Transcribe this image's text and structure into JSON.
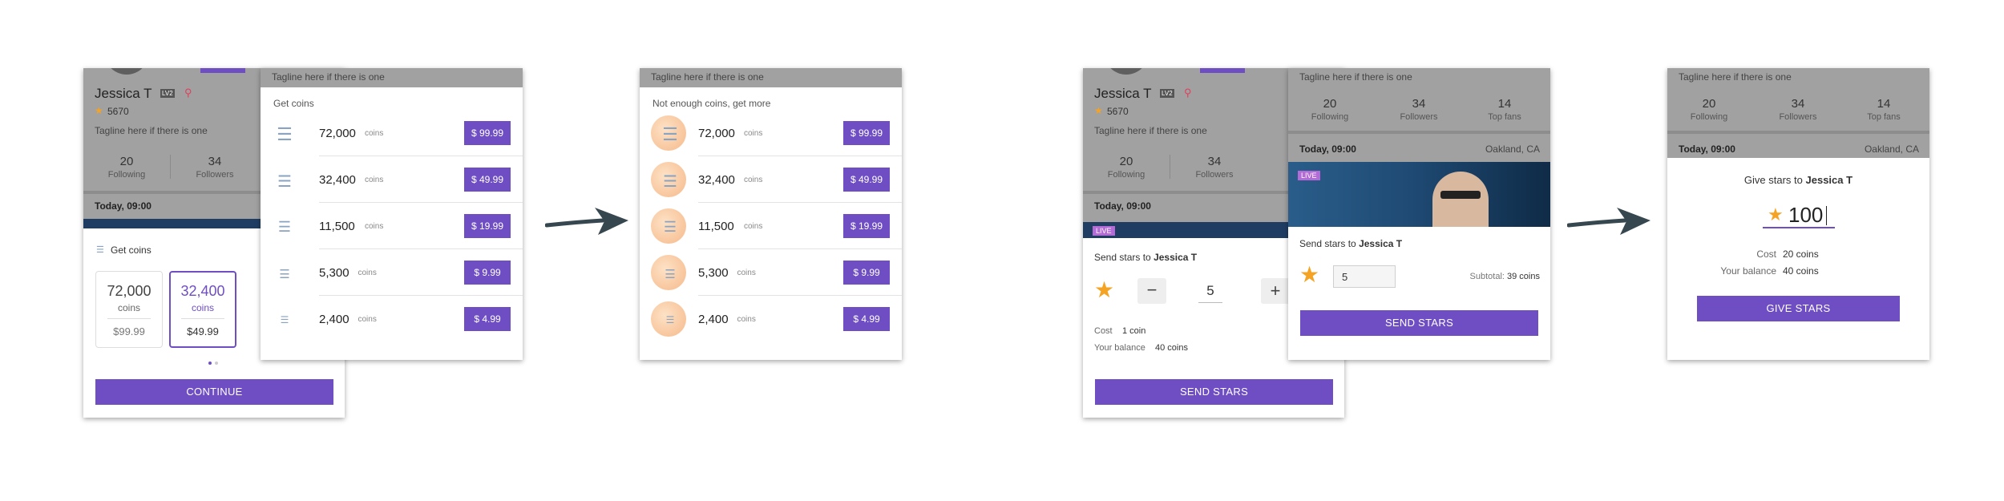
{
  "profile": {
    "name": "Jessica T",
    "level_badge": "LV2",
    "score": "5670",
    "tagline": "Tagline here if there is one",
    "stats": [
      {
        "value": "20",
        "label": "Following"
      },
      {
        "value": "34",
        "label": "Followers"
      },
      {
        "value": "14",
        "label": "Top fans"
      }
    ],
    "schedule": "Today, 09:00",
    "location": "Oakland, CA",
    "live_badge": "LIVE"
  },
  "coin_picker": {
    "title": "Get coins",
    "options": [
      {
        "amount": "72,000",
        "unit": "coins",
        "price": "$99.99",
        "selected": false
      },
      {
        "amount": "32,400",
        "unit": "coins",
        "price": "$49.99",
        "selected": true
      }
    ],
    "continue_label": "CONTINUE"
  },
  "coin_list": {
    "title": "Get coins",
    "items": [
      {
        "amount": "72,000",
        "unit": "coins",
        "price": "$ 99.99"
      },
      {
        "amount": "32,400",
        "unit": "coins",
        "price": "$ 49.99"
      },
      {
        "amount": "11,500",
        "unit": "coins",
        "price": "$ 19.99"
      },
      {
        "amount": "5,300",
        "unit": "coins",
        "price": "$ 9.99"
      },
      {
        "amount": "2,400",
        "unit": "coins",
        "price": "$ 4.99"
      }
    ]
  },
  "coin_list_more": {
    "title": "Not enough coins, get more",
    "items": [
      {
        "amount": "72,000",
        "unit": "coins",
        "price": "$ 99.99"
      },
      {
        "amount": "32,400",
        "unit": "coins",
        "price": "$ 49.99"
      },
      {
        "amount": "11,500",
        "unit": "coins",
        "price": "$ 19.99"
      },
      {
        "amount": "5,300",
        "unit": "coins",
        "price": "$ 9.99"
      },
      {
        "amount": "2,400",
        "unit": "coins",
        "price": "$ 4.99"
      }
    ]
  },
  "send_stars_stepper": {
    "title_prefix": "Send stars to",
    "recipient": "Jessica T",
    "quantity": "5",
    "minus": "−",
    "plus": "+",
    "cost_label": "Cost",
    "cost_value": "1 coin",
    "balance_label": "Your balance",
    "balance_value": "40 coins",
    "button_label": "SEND STARS"
  },
  "send_stars_input": {
    "title_prefix": "Send stars to",
    "recipient": "Jessica T",
    "quantity": "5",
    "subtotal_label": "Subtotal:",
    "subtotal_value": "39 coins",
    "button_label": "SEND STARS"
  },
  "give_stars": {
    "title_prefix": "Give stars to",
    "recipient": "Jessica T",
    "amount": "100",
    "cost_label": "Cost",
    "cost_value": "20 coins",
    "balance_label": "Your balance",
    "balance_value": "40 coins",
    "button_label": "GIVE STARS"
  },
  "colors": {
    "accent": "#6f4ec4",
    "star": "#f4a322",
    "arrow": "#37474f",
    "live_badge": "#b36bd6"
  }
}
